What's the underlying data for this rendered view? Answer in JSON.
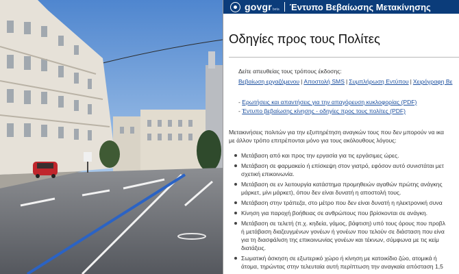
{
  "header": {
    "logo_text": "govgr",
    "logo_badge": "beta",
    "service_title": "Έντυπο Βεβαίωσης Μετακίνησης"
  },
  "page": {
    "title": "Οδηγίες προς τους Πολίτες",
    "intro": "Δείτε απευθείας τους τρόπους έκδοσης:",
    "methods": [
      "Βεβαίωση εργαζόμενου",
      "Αποστολή SMS",
      "Συμπλήρωση Εντύπου",
      "Χειρόγραφη Βε"
    ],
    "pdf_links": [
      "Ερωτήσεις και απαντήσεις για την απαγόρευση κυκλοφορίας (PDF)",
      "Έντυπο βεβαίωσης κίνησης - οδηγίες προς τους πολίτες (PDF)"
    ],
    "paragraph": [
      "Μετακινήσεις πολιτών για την εξυπηρέτηση αναγκών τους που δεν μπορούν να ικα",
      "με άλλον τρόπο επιτρέπονται μόνο για τους ακόλουθους λόγους:"
    ],
    "rules": [
      [
        "Μετάβαση από και προς την εργασία για τις εργάσιμες ώρες."
      ],
      [
        "Μετάβαση σε φαρμακείο ή επίσκεψη στον γιατρό, εφόσον αυτό συνιστάται μετ",
        "σχετική επικοινωνία."
      ],
      [
        "Μετάβαση σε εν λειτουργία κατάστημα προμηθειών αγαθών πρώτης ανάγκης",
        "μάρκετ, μίνι μάρκετ), όπου δεν είναι δυνατή η αποστολή τους."
      ],
      [
        "Μετάβαση στην τράπεζα, στο μέτρο που δεν είναι δυνατή η ηλεκτρονική συνα"
      ],
      [
        "Κίνηση για παροχή βοήθειας σε ανθρώπους που βρίσκονται σε ανάγκη."
      ],
      [
        "Μετάβαση σε τελετή (π.χ. κηδεία, γάμος, βάφτιση) υπό τους όρους που προβλ",
        "ή μετάβαση διαζευγμένων γονέων ή γονέων που τελούν σε διάσταση που είνα",
        "για τη διασφάλιση της επικοινωνίας γονέων και τέκνων, σύμφωνα με τις κείμ",
        "διατάξεις."
      ],
      [
        "Σωματική άσκηση σε εξωτερικό χώρο ή κίνηση με κατοικίδιο ζώο, ατομικά ή",
        "άτομα, τηρώντας στην τελευταία αυτή περίπτωση την αναγκαία απόσταση 1,5"
      ]
    ]
  },
  "colors": {
    "header_bg": "#0b3c7a",
    "link": "#1a4e9e",
    "sky": "#6f9fd6"
  }
}
